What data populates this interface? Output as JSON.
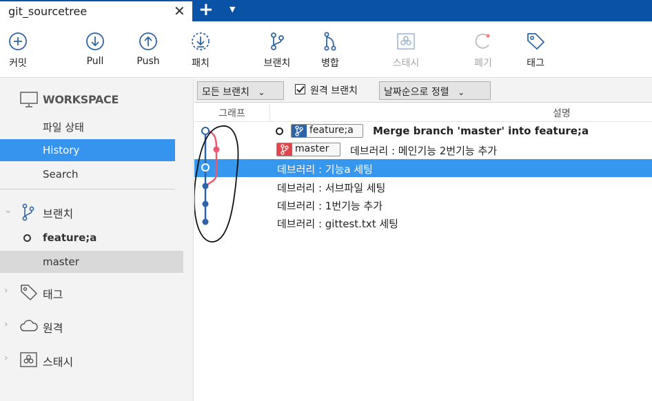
{
  "tab": {
    "title": "git_sourcetree",
    "close_glyph": "✕",
    "new_tab_glyph": "+",
    "menu_glyph": "▼"
  },
  "toolbar": {
    "commit": "커밋",
    "pull": "Pull",
    "push": "Push",
    "patch": "패치",
    "branch": "브랜치",
    "merge": "병합",
    "stash": "스태시",
    "discard": "폐기",
    "tag": "태그"
  },
  "sidebar": {
    "workspace": "WORKSPACE",
    "file_status": "파일 상태",
    "history": "History",
    "search": "Search",
    "branches": "브랜치",
    "branch_items": [
      "feature;a",
      "master"
    ],
    "tags": "태그",
    "remotes": "원격",
    "stashes": "스태시",
    "chevron": "›",
    "chevron_open": "⌄"
  },
  "filters": {
    "branch_filter": "모든 브랜치",
    "remote_branches": "원격 브랜치",
    "remote_branches_checked": true,
    "sort": "날짜순으로 정렬",
    "dropdown_arrow": "⌄"
  },
  "columns": {
    "graph": "그래프",
    "description": "설명"
  },
  "commits": [
    {
      "message": "Merge branch 'master' into feature;a",
      "branch_tag": "feature;a",
      "head": true
    },
    {
      "message": "데브러리 : 메인기능 2번기능 추가",
      "branch_tag": "master"
    },
    {
      "message": "데브러리 : 기능a 세팅",
      "selected": true
    },
    {
      "message": "데브러리 : 서브파일 세팅"
    },
    {
      "message": "데브러리 : 1번기능 추가"
    },
    {
      "message": "데브러리 : gittest.txt 세팅"
    }
  ],
  "colors": {
    "title_bar": "#0a52a6",
    "selection": "#3597ed",
    "graph_blue": "#2d64a8",
    "graph_red": "#e85a73"
  }
}
